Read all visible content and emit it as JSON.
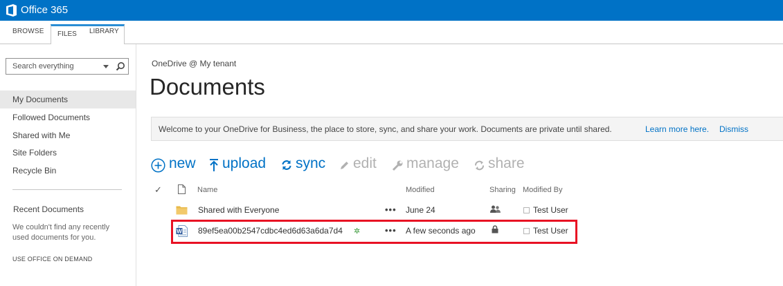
{
  "suitebar": {
    "title": "Office 365",
    "color": "#0072c6"
  },
  "ribbon": {
    "tabs": [
      "BROWSE",
      "FILES",
      "LIBRARY"
    ],
    "active_tab": "FILES"
  },
  "search": {
    "placeholder": "Search everything"
  },
  "nav": {
    "items": [
      "My Documents",
      "Followed Documents",
      "Shared with Me",
      "Site Folders",
      "Recycle Bin"
    ],
    "selected": "My Documents"
  },
  "recent": {
    "title": "Recent Documents",
    "empty_text": "We couldn't find any recently used documents for you.",
    "office_on_demand": "USE OFFICE ON DEMAND"
  },
  "main": {
    "breadcrumb": "OneDrive @ My tenant",
    "title": "Documents"
  },
  "welcome": {
    "text": "Welcome to your OneDrive for Business, the place to store, sync, and share your work. Documents are private until shared.",
    "learn_more": "Learn more here.",
    "dismiss": "Dismiss"
  },
  "commands": {
    "new": "new",
    "upload": "upload",
    "sync": "sync",
    "edit": "edit",
    "manage": "manage",
    "share": "share"
  },
  "list": {
    "headers": {
      "name": "Name",
      "modified": "Modified",
      "sharing": "Sharing",
      "modified_by": "Modified By"
    },
    "rows": [
      {
        "name": "Shared with Everyone",
        "type": "folder-icon",
        "ellipsis": "•••",
        "modified": "June 24",
        "sharing": "people-icon",
        "modified_by": "Test User"
      },
      {
        "name": "89ef5ea00b2547cdbc4ed6d63a6da7d4",
        "type": "word-doc-icon",
        "ellipsis": "•••",
        "modified": "A few seconds ago",
        "sharing": "lock-icon",
        "modified_by": "Test User",
        "new_badge": "✲",
        "highlighted": true
      }
    ]
  },
  "colors": {
    "accent": "#0072c6",
    "disabled": "#b1b1b1",
    "highlight": "#e81123"
  }
}
